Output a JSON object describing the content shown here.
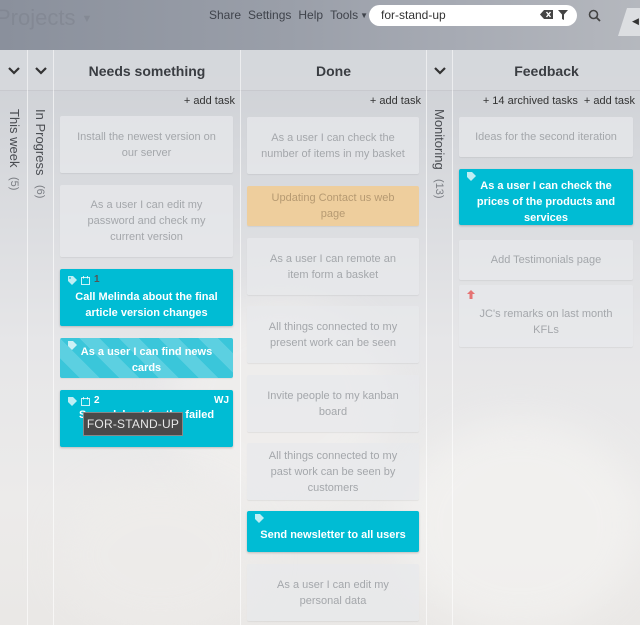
{
  "app": {
    "projects_label": "Projects"
  },
  "topnav": {
    "share": "Share",
    "settings": "Settings",
    "help": "Help",
    "tools": "Tools"
  },
  "search": {
    "value": "for-stand-up",
    "clear_icon": "backspace-icon",
    "filter_icon": "filter-icon",
    "search_icon": "search-icon"
  },
  "lanes": {
    "this_week": {
      "label": "This week",
      "count": "(5)"
    },
    "in_progress": {
      "label": "In Progress",
      "count": "(6)"
    },
    "monitoring": {
      "label": "Monitoring",
      "count": "(13)"
    }
  },
  "columns": [
    {
      "title": "Needs something",
      "add_task": "+ add task",
      "cards": [
        {
          "text": "Install the newest version on our server",
          "style": "faded"
        },
        {
          "text": "As a user I can edit my password and check my current version",
          "style": "faded"
        },
        {
          "text": "Call Melinda about the final article version changes",
          "style": "blue",
          "has_tag": true,
          "has_due": true,
          "count": "1"
        },
        {
          "text": "As a user I can find news cards",
          "style": "striped",
          "has_tag": true
        },
        {
          "text": "Spreadsheet for the failed",
          "style": "blue",
          "has_tag": true,
          "has_due": true,
          "count": "2",
          "initials": "WJ"
        }
      ]
    },
    {
      "title": "Done",
      "add_task": "+ add task",
      "cards": [
        {
          "text": "As a user I can check the number of items in my basket",
          "style": "faded"
        },
        {
          "text": "Updating Contact us web page",
          "style": "orange"
        },
        {
          "text": "As a user I can remote an item form a basket",
          "style": "faded"
        },
        {
          "text": "All things connected to my present work can be seen",
          "style": "faded"
        },
        {
          "text": "Invite people to my kanban board",
          "style": "faded"
        },
        {
          "text": "All things connected to my past work can be seen by customers",
          "style": "faded"
        },
        {
          "text": "Send newsletter to all users",
          "style": "blue",
          "has_tag": true
        },
        {
          "text": "As a user I can edit my personal data",
          "style": "faded"
        }
      ]
    },
    {
      "title": "Feedback",
      "archived": "+ 14 archived tasks",
      "add_task": "+ add task",
      "cards": [
        {
          "text": "Ideas for the second iteration",
          "style": "faded"
        },
        {
          "text": "As a user I can check the prices of the products and services",
          "style": "blue",
          "has_tag": true
        },
        {
          "text": "Add Testimonials page",
          "style": "faded"
        },
        {
          "text": "JC's remarks on last month KFLs",
          "style": "faded",
          "priority": "high"
        }
      ]
    }
  ],
  "tooltip": {
    "text": "FOR-STAND-UP"
  },
  "colors": {
    "accent": "#00bcd4",
    "orange_card": "#f0cc96",
    "priority_up": "#e57373"
  }
}
